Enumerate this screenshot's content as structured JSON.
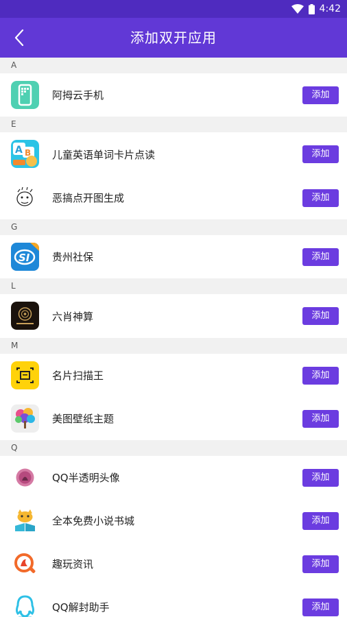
{
  "status_bar": {
    "time": "4:42"
  },
  "app_bar": {
    "title": "添加双开应用"
  },
  "sections": [
    {
      "letter": "A",
      "apps": [
        {
          "name": "阿拇云手机",
          "icon": "phone-grid-icon",
          "button": "添加"
        }
      ]
    },
    {
      "letter": "E",
      "apps": [
        {
          "name": "儿童英语单词卡片点读",
          "icon": "abc-cards-icon",
          "button": "添加"
        },
        {
          "name": "恶搞点开图生成",
          "icon": "meme-face-icon",
          "button": "添加"
        }
      ]
    },
    {
      "letter": "G",
      "apps": [
        {
          "name": "贵州社保",
          "icon": "si-logo-icon",
          "button": "添加"
        }
      ]
    },
    {
      "letter": "L",
      "apps": [
        {
          "name": "六肖神算",
          "icon": "dark-circle-icon",
          "button": "添加"
        }
      ]
    },
    {
      "letter": "M",
      "apps": [
        {
          "name": "名片扫描王",
          "icon": "card-scan-icon",
          "button": "添加"
        },
        {
          "name": "美图壁纸主题",
          "icon": "colorful-tree-icon",
          "button": "添加"
        }
      ]
    },
    {
      "letter": "Q",
      "apps": [
        {
          "name": "QQ半透明头像",
          "icon": "avatar-circle-icon",
          "button": "添加"
        },
        {
          "name": "全本免费小说书城",
          "icon": "cat-reading-icon",
          "button": "添加"
        },
        {
          "name": "趣玩资讯",
          "icon": "search-magnifier-icon",
          "button": "添加"
        },
        {
          "name": "QQ解封助手",
          "icon": "qq-penguin-icon",
          "button": "添加"
        }
      ]
    }
  ],
  "colors": {
    "status_bar": "#4f2bbf",
    "app_bar": "#6138d6",
    "button": "#6b3ce0",
    "section_bg": "#f1f1f1"
  }
}
